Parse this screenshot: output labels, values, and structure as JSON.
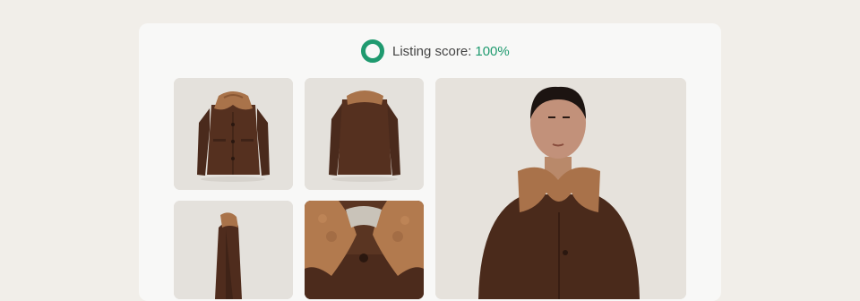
{
  "listing": {
    "score_label": "Listing score:",
    "score_value": "100%",
    "accent_color": "#1f9a6f",
    "score_icon": "progress-ring-icon"
  },
  "gallery": {
    "photos": [
      {
        "name": "photo-jacket-front",
        "subject": "jacket front"
      },
      {
        "name": "photo-jacket-back",
        "subject": "jacket back"
      },
      {
        "name": "photo-jacket-side",
        "subject": "jacket side"
      },
      {
        "name": "photo-collar-detail",
        "subject": "collar detail"
      },
      {
        "name": "photo-model-wearing",
        "subject": "model wearing jacket"
      }
    ]
  }
}
